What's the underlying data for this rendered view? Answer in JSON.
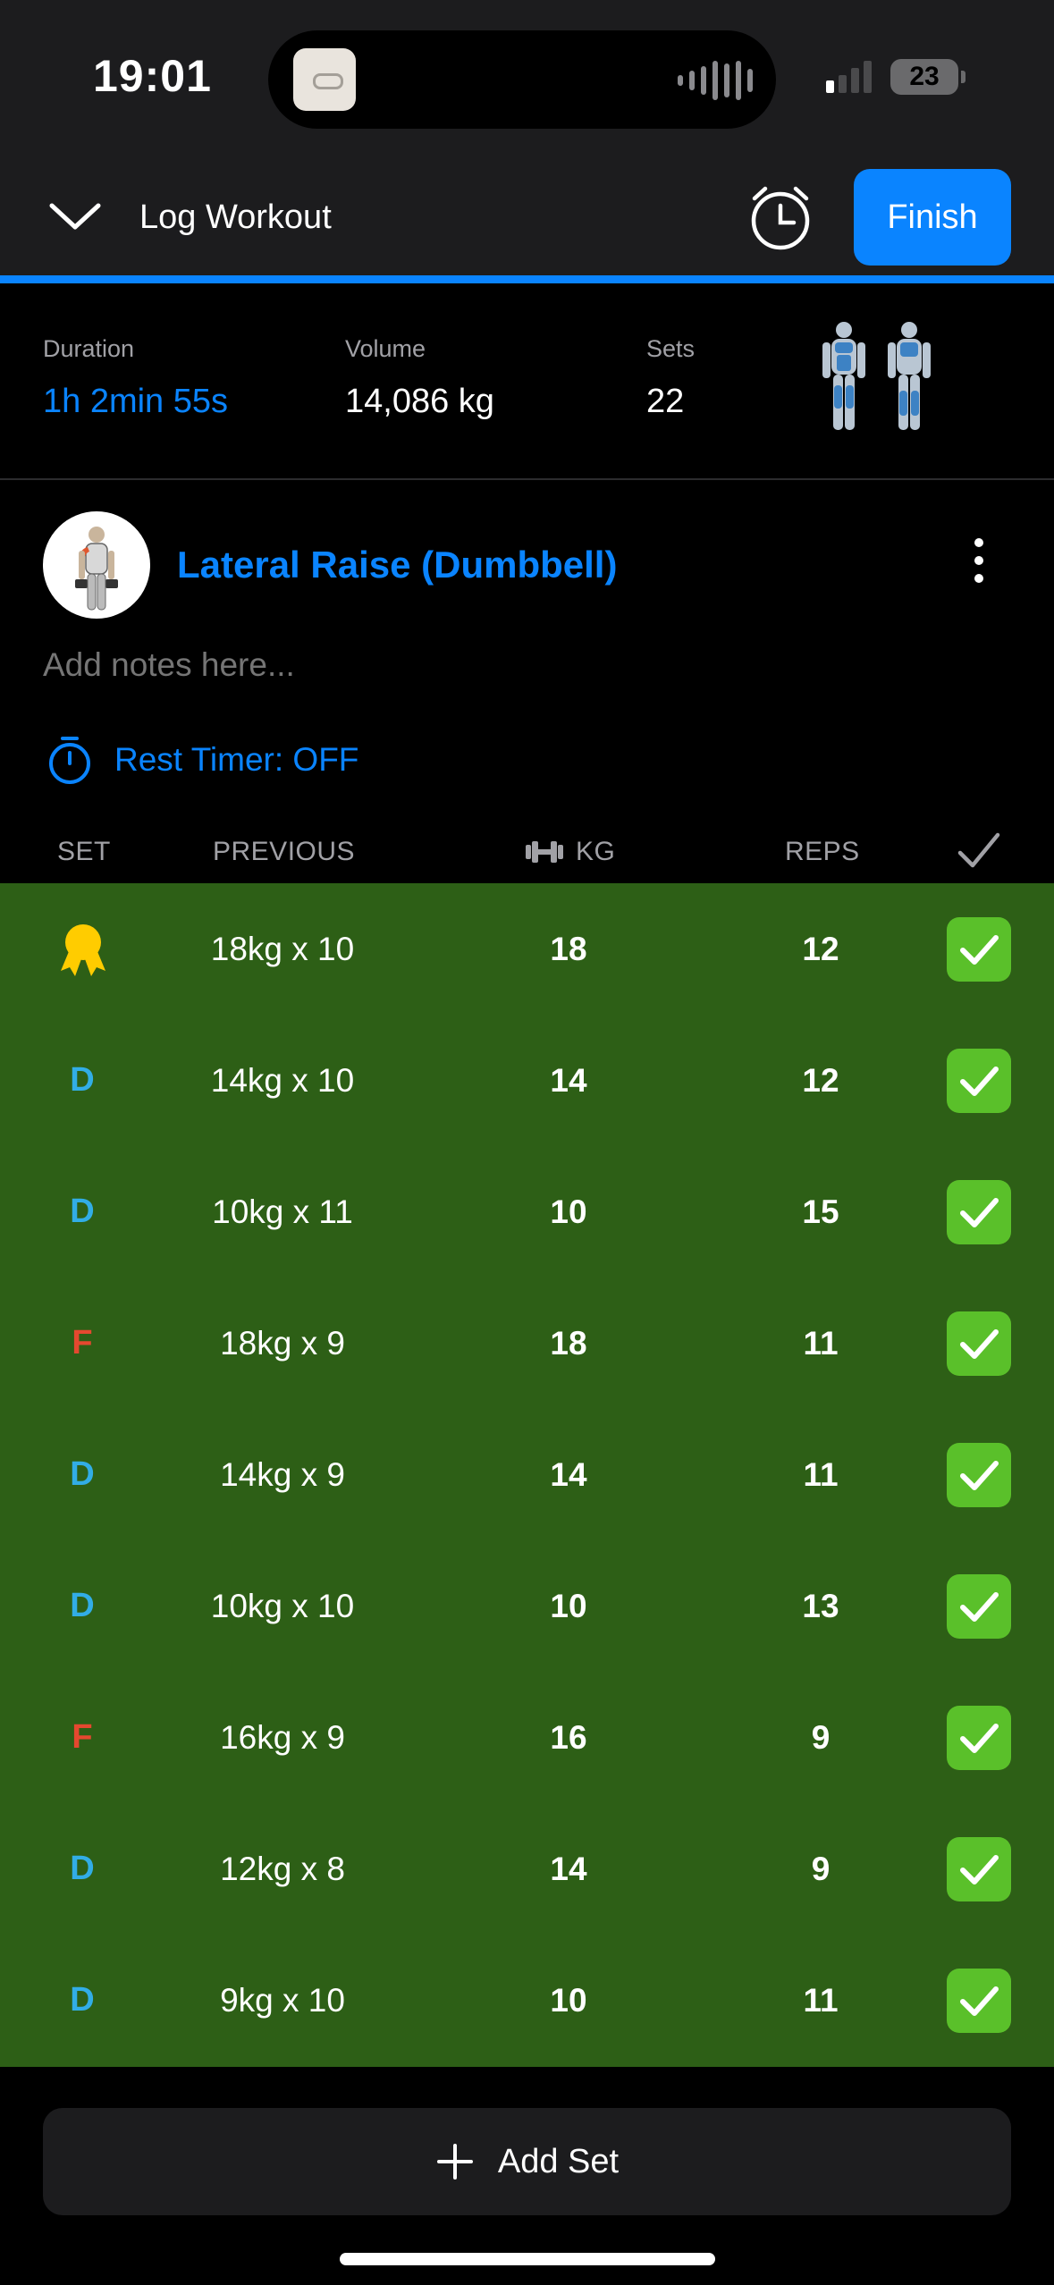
{
  "status_bar": {
    "time": "19:01",
    "battery": "23"
  },
  "header": {
    "title": "Log Workout",
    "finish_label": "Finish"
  },
  "stats": {
    "duration": {
      "label": "Duration",
      "value": "1h 2min 55s"
    },
    "volume": {
      "label": "Volume",
      "value": "14,086 kg"
    },
    "sets": {
      "label": "Sets",
      "value": "22"
    }
  },
  "exercise": {
    "title": "Lateral Raise (Dumbbell)",
    "notes_placeholder": "Add notes here...",
    "rest_timer": "Rest Timer: OFF"
  },
  "table": {
    "headers": {
      "set": "SET",
      "previous": "PREVIOUS",
      "kg": "KG",
      "reps": "REPS"
    },
    "rows": [
      {
        "set": "",
        "set_type": "pr-medal",
        "previous": "18kg x 10",
        "kg": "18",
        "reps": "12",
        "done": true
      },
      {
        "set": "D",
        "set_type": "drop",
        "previous": "14kg x 10",
        "kg": "14",
        "reps": "12",
        "done": true
      },
      {
        "set": "D",
        "set_type": "drop",
        "previous": "10kg x 11",
        "kg": "10",
        "reps": "15",
        "done": true
      },
      {
        "set": "F",
        "set_type": "failure",
        "previous": "18kg x 9",
        "kg": "18",
        "reps": "11",
        "done": true
      },
      {
        "set": "D",
        "set_type": "drop",
        "previous": "14kg x 9",
        "kg": "14",
        "reps": "11",
        "done": true
      },
      {
        "set": "D",
        "set_type": "drop",
        "previous": "10kg x 10",
        "kg": "10",
        "reps": "13",
        "done": true
      },
      {
        "set": "F",
        "set_type": "failure",
        "previous": "16kg x 9",
        "kg": "16",
        "reps": "9",
        "done": true
      },
      {
        "set": "D",
        "set_type": "drop",
        "previous": "12kg x 8",
        "kg": "14",
        "reps": "9",
        "done": true
      },
      {
        "set": "D",
        "set_type": "drop",
        "previous": "9kg x 10",
        "kg": "10",
        "reps": "11",
        "done": true
      }
    ]
  },
  "add_set_label": "Add Set",
  "colors": {
    "accent": "#0a84ff",
    "row_done_bg": "#2d5f16",
    "check_green": "#5ac02a",
    "drop_set": "#32ade6",
    "failure_set": "#e5482f",
    "medal": "#ffcc00"
  },
  "icons": {
    "collapse": "chevron-down-icon",
    "timer": "alarm-clock-icon",
    "more": "more-vertical-icon",
    "rest": "stopwatch-icon",
    "kg": "dumbbell-icon",
    "done": "checkmark-icon",
    "add": "plus-icon"
  }
}
